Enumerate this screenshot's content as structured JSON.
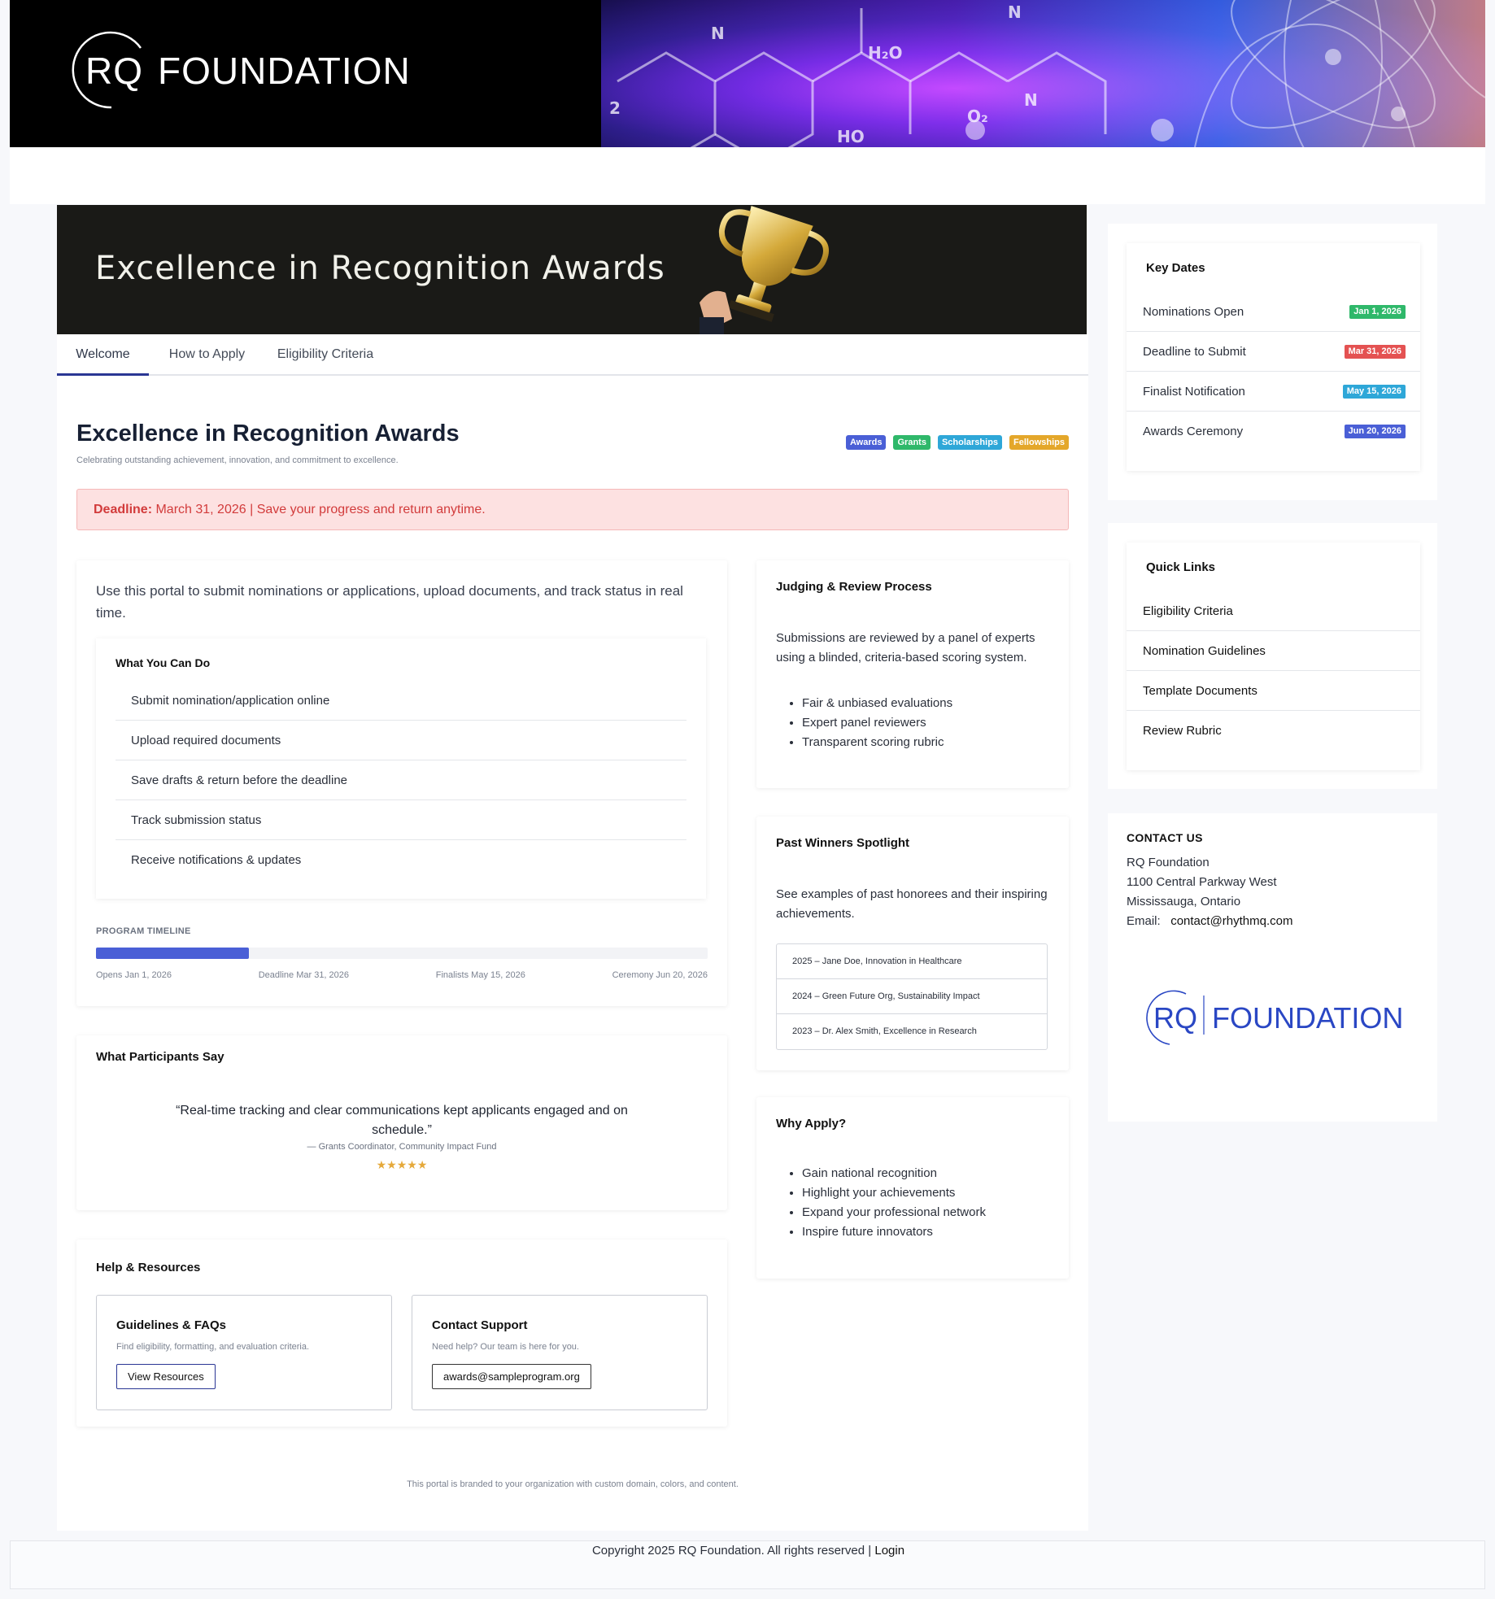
{
  "brand": {
    "rq": "RQ",
    "foundation": "FOUNDATION"
  },
  "hero": {
    "title": "Excellence in Recognition Awards"
  },
  "tabs": [
    {
      "label": "Welcome"
    },
    {
      "label": "How to Apply"
    },
    {
      "label": "Eligibility Criteria"
    }
  ],
  "page": {
    "title": "Excellence in Recognition Awards",
    "subtitle": "Celebrating outstanding achievement, innovation, and commitment to excellence.",
    "chips": [
      {
        "label": "Awards",
        "color": "#4a5fd6"
      },
      {
        "label": "Grants",
        "color": "#2fb86a"
      },
      {
        "label": "Scholarships",
        "color": "#2ea7d8"
      },
      {
        "label": "Fellowships",
        "color": "#e4a72a"
      }
    ],
    "deadline": {
      "label": "Deadline:",
      "text": "March 31, 2026  |  Save your progress and return anytime."
    }
  },
  "intro": {
    "lead": "Use this portal to submit nominations or applications, upload documents, and track status in real time.",
    "can_do_title": "What You Can Do",
    "can_do": [
      "Submit nomination/application online",
      "Upload required documents",
      "Save drafts & return before the deadline",
      "Track submission status",
      "Receive notifications & updates"
    ],
    "timeline": {
      "label": "PROGRAM TIMELINE",
      "progress": 0.25,
      "steps": [
        "Opens Jan 1, 2026",
        "Deadline Mar 31, 2026",
        "Finalists May 15, 2026",
        "Ceremony Jun 20, 2026"
      ]
    }
  },
  "quote": {
    "title": "What Participants Say",
    "text": "“Real-time tracking and clear communications kept applicants engaged and on schedule.”",
    "who": "— Grants Coordinator, Community Impact Fund",
    "stars": "★★★★★"
  },
  "help": {
    "title": "Help & Resources",
    "guidelines": {
      "title": "Guidelines & FAQs",
      "desc": "Find eligibility, formatting, and evaluation criteria.",
      "button": "View Resources"
    },
    "support": {
      "title": "Contact Support",
      "desc": "Need help? Our team is here for you.",
      "button": "awards@sampleprogram.org"
    }
  },
  "judging": {
    "title": "Judging & Review Process",
    "body": "Submissions are reviewed by a panel of experts using a blinded, criteria-based scoring system.",
    "points": [
      "Fair & unbiased evaluations",
      "Expert panel reviewers",
      "Transparent scoring rubric"
    ]
  },
  "winners": {
    "title": "Past Winners Spotlight",
    "body": "See examples of past honorees and their inspiring achievements.",
    "items": [
      "2025 – Jane Doe, Innovation in Healthcare",
      "2024 – Green Future Org, Sustainability Impact",
      "2023 – Dr. Alex Smith, Excellence in Research"
    ]
  },
  "why": {
    "title": "Why Apply?",
    "points": [
      "Gain national recognition",
      "Highlight your achievements",
      "Expand your professional network",
      "Inspire future innovators"
    ]
  },
  "branded_note": "This portal is branded to your organization with custom domain, colors, and content.",
  "key_dates": {
    "title": "Key Dates",
    "items": [
      {
        "label": "Nominations Open",
        "date": "Jan 1, 2026",
        "color": "#2fb86a"
      },
      {
        "label": "Deadline to Submit",
        "date": "Mar 31, 2026",
        "color": "#e45252"
      },
      {
        "label": "Finalist Notification",
        "date": "May 15, 2026",
        "color": "#2ea7d8"
      },
      {
        "label": "Awards Ceremony",
        "date": "Jun 20, 2026",
        "color": "#4a5fd6"
      }
    ]
  },
  "quick_links": {
    "title": "Quick Links",
    "items": [
      "Eligibility Criteria",
      "Nomination Guidelines",
      "Template Documents",
      "Review Rubric"
    ]
  },
  "contact": {
    "title": "CONTACT US",
    "lines": [
      "RQ Foundation",
      "1100 Central Parkway West",
      "Mississauga, Ontario"
    ],
    "email_label": "Email:",
    "email": "contact@rhythmq.com"
  },
  "footer": {
    "copyright": "Copyright  2025 RQ Foundation.  All rights reserved | ",
    "login": "Login"
  }
}
